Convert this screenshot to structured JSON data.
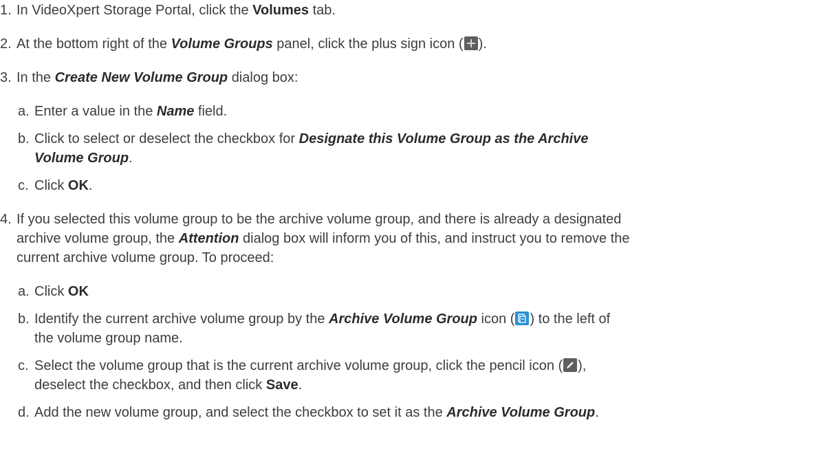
{
  "steps": [
    {
      "num": "1.",
      "pre": "In VideoXpert Storage Portal, click the ",
      "bold": "Volumes",
      "post": " tab."
    },
    {
      "num": "2.",
      "pre": "At the bottom right of the ",
      "ital": "Volume Groups",
      "mid": " panel, click the plus sign icon (",
      "post": ")."
    },
    {
      "num": "3.",
      "pre": "In the ",
      "ital": "Create New Volume Group",
      "post": " dialog box:",
      "subs": [
        {
          "num": "a.",
          "pre": "Enter a value in the ",
          "ital": "Name",
          "post": " field."
        },
        {
          "num": "b.",
          "pre": "Click to select or deselect the checkbox for ",
          "ital1": "Designate this Volume Group as the Archive",
          "ital2": "Volume Group",
          "post": "."
        },
        {
          "num": "c.",
          "pre": "Click ",
          "bold": "OK",
          "post": "."
        }
      ]
    },
    {
      "num": "4.",
      "line1": "If you selected this volume group to be the archive volume group, and there is already a designated",
      "line2_pre": "archive volume group, the ",
      "line2_ital": "Attention",
      "line2_post": " dialog box will inform you of this, and instruct you to remove the",
      "line3": "current archive volume group. To proceed:",
      "subs": [
        {
          "num": "a.",
          "pre": "Click ",
          "bold": "OK"
        },
        {
          "num": "b.",
          "pre": "Identify the current archive volume group by the ",
          "ital": "Archive Volume Group",
          "mid": " icon (",
          "post": ") to the left of",
          "line2": "the volume group name."
        },
        {
          "num": "c.",
          "pre": "Select the volume group that is the current archive volume group, click the pencil icon (",
          "post": "),",
          "line2_pre": "deselect the checkbox, and then click ",
          "line2_bold": "Save",
          "line2_post": "."
        },
        {
          "num": "d.",
          "pre": "Add the new volume group, and select the checkbox to set it as the ",
          "ital": "Archive Volume Group",
          "post": "."
        }
      ]
    }
  ],
  "icons": {
    "plus": "plus-icon",
    "archive": "archive-volume-group-icon",
    "pencil": "pencil-icon"
  },
  "colors": {
    "text": "#3d3d3d",
    "archive_icon": "#2a8fd6",
    "toolbar_icon": "#5e5e5e"
  }
}
